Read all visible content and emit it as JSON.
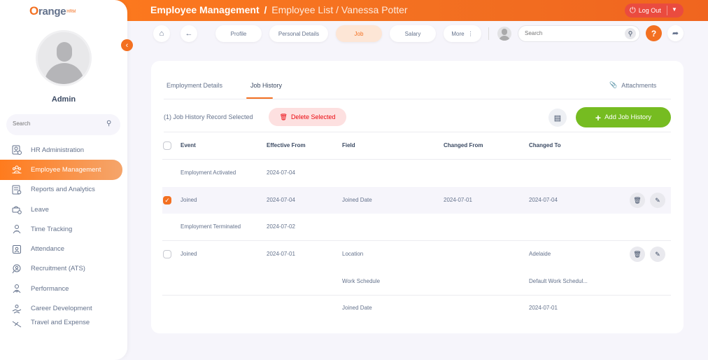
{
  "header": {
    "module": "Employee Management",
    "breadcrumb_sep": "/",
    "page": "Employee List",
    "employee": "Vanessa Potter",
    "logout_label": "Log Out"
  },
  "sidebar": {
    "brand": "OrangeHRM",
    "username": "Admin",
    "search_placeholder": "Search",
    "items": [
      {
        "label": "HR Administration",
        "icon": "id-card-icon"
      },
      {
        "label": "Employee Management",
        "icon": "people-icon"
      },
      {
        "label": "Reports and Analytics",
        "icon": "report-icon"
      },
      {
        "label": "Leave",
        "icon": "leave-icon"
      },
      {
        "label": "Time Tracking",
        "icon": "time-icon"
      },
      {
        "label": "Attendance",
        "icon": "attendance-icon"
      },
      {
        "label": "Recruitment (ATS)",
        "icon": "recruitment-icon"
      },
      {
        "label": "Performance",
        "icon": "performance-icon"
      },
      {
        "label": "Career Development",
        "icon": "career-icon"
      },
      {
        "label": "Travel and Expense",
        "icon": "travel-icon"
      }
    ]
  },
  "toolbar": {
    "tabs": [
      "Profile",
      "Personal Details",
      "Job",
      "Salary",
      "More"
    ],
    "active_tab": "Job",
    "search_placeholder": "Search",
    "help_label": "?"
  },
  "card": {
    "tabs": [
      "Employment Details",
      "Job History"
    ],
    "active_tab": "Job History",
    "attachments_label": "Attachments",
    "selected_text": "(1) Job History Record Selected",
    "delete_label": "Delete Selected",
    "add_label": "Add Job History",
    "columns": [
      "Event",
      "Effective From",
      "Field",
      "Changed From",
      "Changed To"
    ],
    "rows": [
      {
        "event": "Employment Activated",
        "effective": "2024-07-04",
        "field": "",
        "from": "",
        "to": "",
        "checkbox": false,
        "checked": false,
        "actions": false,
        "highlight": false
      },
      {
        "event": "Joined",
        "effective": "2024-07-04",
        "field": "Joined Date",
        "from": "2024-07-01",
        "to": "2024-07-04",
        "checkbox": true,
        "checked": true,
        "actions": true,
        "highlight": true
      },
      {
        "event": "Employment Terminated",
        "effective": "2024-07-02",
        "field": "",
        "from": "",
        "to": "",
        "checkbox": false,
        "checked": false,
        "actions": false,
        "highlight": false
      },
      {
        "event": "Joined",
        "effective": "2024-07-01",
        "field": "Location",
        "from": "",
        "to": "Adelaide",
        "checkbox": true,
        "checked": false,
        "actions": true,
        "highlight": false
      },
      {
        "event": "",
        "effective": "",
        "field": "Work Schedule",
        "from": "",
        "to": "Default Work Schedul...",
        "checkbox": false,
        "checked": false,
        "actions": false,
        "highlight": false
      },
      {
        "event": "",
        "effective": "",
        "field": "Joined Date",
        "from": "",
        "to": "2024-07-01",
        "checkbox": false,
        "checked": false,
        "actions": false,
        "highlight": false
      }
    ]
  },
  "colors": {
    "brand_orange": "#f37021",
    "add_green": "#76bc21",
    "delete_red": "#eb0910"
  }
}
